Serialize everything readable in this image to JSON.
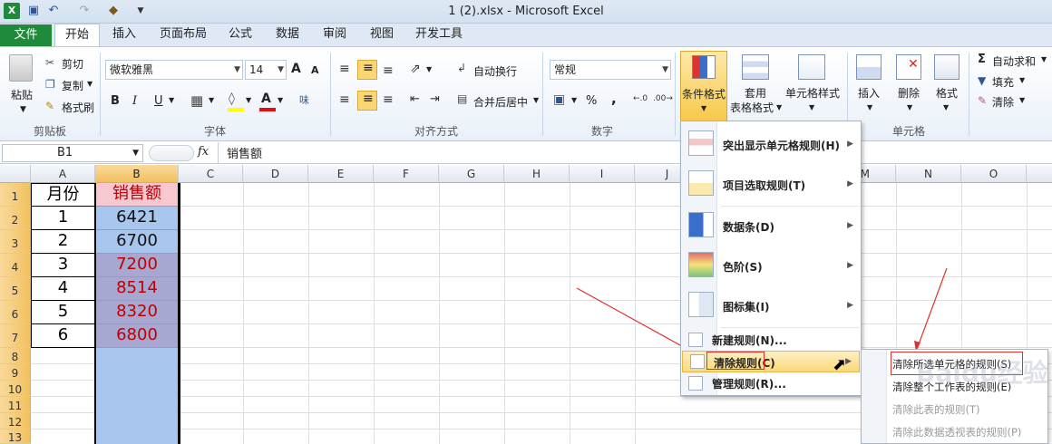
{
  "window": {
    "title": "1 (2).xlsx - Microsoft Excel"
  },
  "tabs": [
    "文件",
    "开始",
    "插入",
    "页面布局",
    "公式",
    "数据",
    "审阅",
    "视图",
    "开发工具"
  ],
  "ribbon": {
    "clipboard": {
      "paste": "粘贴",
      "cut": "剪切",
      "copy": "复制",
      "format_painter": "格式刷",
      "label": "剪贴板"
    },
    "font": {
      "name": "微软雅黑",
      "size": "14",
      "grow": "A",
      "shrink": "A",
      "bold": "B",
      "italic": "I",
      "underline": "U",
      "label": "字体"
    },
    "alignment": {
      "wrap": "自动换行",
      "merge": "合并后居中",
      "label": "对齐方式"
    },
    "number": {
      "format": "常规",
      "percent": "%",
      "comma": ",",
      "label": "数字"
    },
    "styles": {
      "conditional": "条件格式",
      "table_line1": "套用",
      "table_line2": "表格格式",
      "cell_styles": "单元格样式"
    },
    "cells": {
      "insert": "插入",
      "delete": "删除",
      "format": "格式",
      "label": "单元格"
    },
    "editing": {
      "autosum": "自动求和",
      "fill": "填充",
      "clear": "清除"
    }
  },
  "formula_bar": {
    "name_box": "B1",
    "fx": "fx",
    "value": "销售额"
  },
  "columns": [
    "A",
    "B",
    "C",
    "D",
    "E",
    "F",
    "G",
    "H",
    "I",
    "J",
    "M",
    "N",
    "O"
  ],
  "rows": [
    "1",
    "2",
    "3",
    "4",
    "5",
    "6",
    "7",
    "8",
    "9",
    "10",
    "11",
    "12",
    "13"
  ],
  "table": {
    "header": {
      "month": "月份",
      "sales": "销售额"
    },
    "data": [
      {
        "month": "1",
        "sales": "6421"
      },
      {
        "month": "2",
        "sales": "6700"
      },
      {
        "month": "3",
        "sales": "7200"
      },
      {
        "month": "4",
        "sales": "8514"
      },
      {
        "month": "5",
        "sales": "8320"
      },
      {
        "month": "6",
        "sales": "6800"
      }
    ]
  },
  "cf_menu": {
    "highlight": "突出显示单元格规则(H)",
    "topbottom": "项目选取规则(T)",
    "databars": "数据条(D)",
    "colorscales": "色阶(S)",
    "iconsets": "图标集(I)",
    "new_rule": "新建规则(N)...",
    "clear_rules": "清除规则(C)",
    "manage_rules": "管理规则(R)..."
  },
  "clear_submenu": {
    "selected_cells": "清除所选单元格的规则(S)",
    "entire_sheet": "清除整个工作表的规则(E)",
    "this_table": "清除此表的规则(T)",
    "this_pivot": "清除此数据透视表的规则(P)"
  },
  "watermark": "Baidu经验 jingyan.baidu.com",
  "colors": {
    "ribbon_bg": "#dfe9f5",
    "file_tab": "#1f8a3b",
    "sel_header": "#f1c15f",
    "sales_red": "#c00000",
    "highlight_fill": "#a9c3e8",
    "pink_fill": "#f7c8d0"
  }
}
